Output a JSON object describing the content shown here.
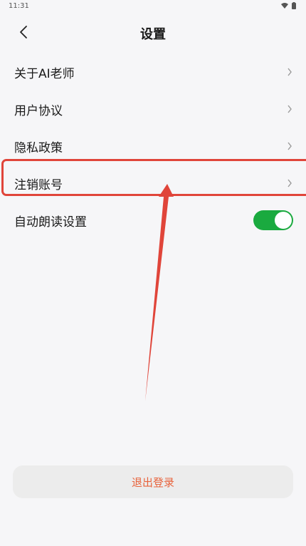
{
  "status_bar": {
    "time": "11:31",
    "icons": [
      "wifi-icon",
      "battery-icon"
    ]
  },
  "header": {
    "title": "设置",
    "back_icon": "chevron-left-icon"
  },
  "settings": {
    "items": [
      {
        "label": "关于AI老师",
        "control": "chevron"
      },
      {
        "label": "用户协议",
        "control": "chevron"
      },
      {
        "label": "隐私政策",
        "control": "chevron"
      },
      {
        "label": "注销账号",
        "control": "chevron",
        "highlighted": true
      },
      {
        "label": "自动朗读设置",
        "control": "toggle",
        "toggle_on": true
      }
    ]
  },
  "logout": {
    "label": "退出登录"
  },
  "colors": {
    "background": "#f6f6f8",
    "toggle_on": "#1aaa3f",
    "annotation_red": "#e0453a",
    "logout_text": "#e8633c",
    "logout_bg": "#ececec"
  }
}
